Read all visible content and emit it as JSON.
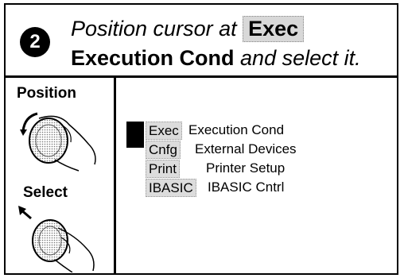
{
  "header": {
    "step_number": "2",
    "line1_text": "Position cursor at",
    "line1_key": "Exec",
    "line2_bold": "Execution Cond",
    "line2_italic": "and select it."
  },
  "instructions": {
    "position_label": "Position",
    "select_label": "Select"
  },
  "menu": {
    "items": [
      {
        "key": "Exec",
        "description": "Execution Cond"
      },
      {
        "key": "Cnfg",
        "description": "External Devices"
      },
      {
        "key": "Print",
        "description": "Printer Setup"
      },
      {
        "key": "IBASIC",
        "description": "IBASIC Cntrl"
      }
    ]
  },
  "colors": {
    "highlight": "#d8d8d8",
    "ink": "#000000"
  },
  "icons": [
    "position-knob-icon",
    "select-knob-icon",
    "cursor-block-icon"
  ]
}
